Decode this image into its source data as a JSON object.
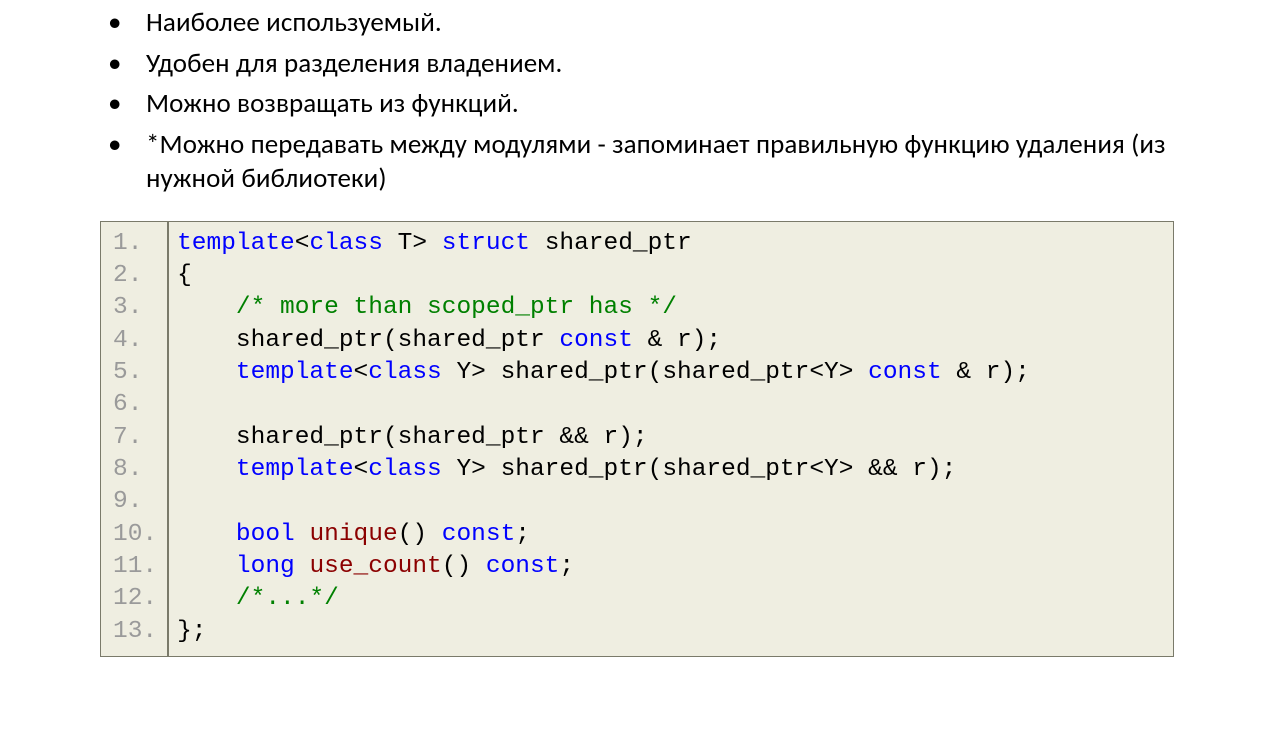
{
  "bullets": [
    "Наиболее используемый.",
    "Удобен для разделения владением.",
    "Можно возвращать из функций.",
    "*Можно передавать между модулями - запоминает правильную функцию удаления (из нужной библиотеки)"
  ],
  "code": {
    "line_count": 13,
    "lines": [
      {
        "n": "1.",
        "t": [
          [
            "kw",
            "template"
          ],
          [
            "punct",
            "<"
          ],
          [
            "kw",
            "class"
          ],
          [
            "punct",
            " "
          ],
          [
            "ident",
            "T"
          ],
          [
            "punct",
            "> "
          ],
          [
            "kw",
            "struct"
          ],
          [
            "punct",
            " "
          ],
          [
            "ident",
            "shared_ptr"
          ]
        ]
      },
      {
        "n": "2.",
        "t": [
          [
            "punct",
            "{"
          ]
        ]
      },
      {
        "n": "3.",
        "t": [
          [
            "punct",
            "    "
          ],
          [
            "cmt",
            "/* more than scoped_ptr has */"
          ]
        ]
      },
      {
        "n": "4.",
        "t": [
          [
            "punct",
            "    "
          ],
          [
            "ident",
            "shared_ptr"
          ],
          [
            "punct",
            "("
          ],
          [
            "ident",
            "shared_ptr"
          ],
          [
            "punct",
            " "
          ],
          [
            "kw",
            "const"
          ],
          [
            "punct",
            " & r);"
          ]
        ]
      },
      {
        "n": "5.",
        "t": [
          [
            "punct",
            "    "
          ],
          [
            "kw",
            "template"
          ],
          [
            "punct",
            "<"
          ],
          [
            "kw",
            "class"
          ],
          [
            "punct",
            " "
          ],
          [
            "ident",
            "Y"
          ],
          [
            "punct",
            "> "
          ],
          [
            "ident",
            "shared_ptr"
          ],
          [
            "punct",
            "("
          ],
          [
            "ident",
            "shared_ptr"
          ],
          [
            "punct",
            "<"
          ],
          [
            "ident",
            "Y"
          ],
          [
            "punct",
            "> "
          ],
          [
            "kw",
            "const"
          ],
          [
            "punct",
            " & r);"
          ]
        ]
      },
      {
        "n": "6.",
        "t": [
          [
            "punct",
            ""
          ]
        ]
      },
      {
        "n": "7.",
        "t": [
          [
            "punct",
            "    "
          ],
          [
            "ident",
            "shared_ptr"
          ],
          [
            "punct",
            "("
          ],
          [
            "ident",
            "shared_ptr"
          ],
          [
            "punct",
            " && r);"
          ]
        ]
      },
      {
        "n": "8.",
        "t": [
          [
            "punct",
            "    "
          ],
          [
            "kw",
            "template"
          ],
          [
            "punct",
            "<"
          ],
          [
            "kw",
            "class"
          ],
          [
            "punct",
            " "
          ],
          [
            "ident",
            "Y"
          ],
          [
            "punct",
            "> "
          ],
          [
            "ident",
            "shared_ptr"
          ],
          [
            "punct",
            "("
          ],
          [
            "ident",
            "shared_ptr"
          ],
          [
            "punct",
            "<"
          ],
          [
            "ident",
            "Y"
          ],
          [
            "punct",
            "> && r);"
          ]
        ]
      },
      {
        "n": "9.",
        "t": [
          [
            "punct",
            ""
          ]
        ]
      },
      {
        "n": "10.",
        "t": [
          [
            "punct",
            "    "
          ],
          [
            "kw",
            "bool"
          ],
          [
            "punct",
            " "
          ],
          [
            "mname",
            "unique"
          ],
          [
            "punct",
            "() "
          ],
          [
            "kw",
            "const"
          ],
          [
            "punct",
            ";"
          ]
        ]
      },
      {
        "n": "11.",
        "t": [
          [
            "punct",
            "    "
          ],
          [
            "kw",
            "long"
          ],
          [
            "punct",
            " "
          ],
          [
            "mname",
            "use_count"
          ],
          [
            "punct",
            "() "
          ],
          [
            "kw",
            "const"
          ],
          [
            "punct",
            ";"
          ]
        ]
      },
      {
        "n": "12.",
        "t": [
          [
            "punct",
            "    "
          ],
          [
            "cmt",
            "/*...*/"
          ]
        ]
      },
      {
        "n": "13.",
        "t": [
          [
            "punct",
            "};"
          ]
        ]
      }
    ]
  }
}
